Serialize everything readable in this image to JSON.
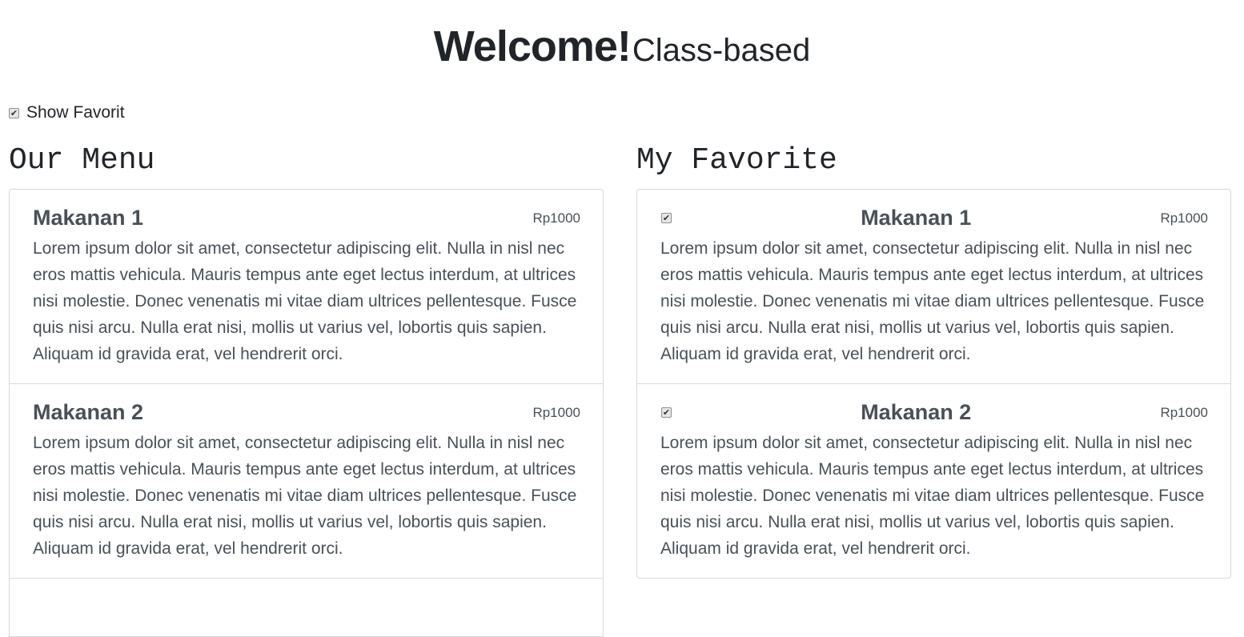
{
  "header": {
    "title": "Welcome!",
    "subtitle": "Class-based"
  },
  "toggle": {
    "label": "Show Favorit",
    "checked": true,
    "check_glyph": "✔"
  },
  "menu": {
    "heading": "Our Menu",
    "items": [
      {
        "name": "Makanan 1",
        "price": "Rp1000",
        "description": "Lorem ipsum dolor sit amet, consectetur adipiscing elit. Nulla in nisl nec eros mattis vehicula. Mauris tempus ante eget lectus interdum, at ultrices nisi molestie. Donec venenatis mi vitae diam ultrices pellentesque. Fusce quis nisi arcu. Nulla erat nisi, mollis ut varius vel, lobortis quis sapien. Aliquam id gravida erat, vel hendrerit orci."
      },
      {
        "name": "Makanan 2",
        "price": "Rp1000",
        "description": "Lorem ipsum dolor sit amet, consectetur adipiscing elit. Nulla in nisl nec eros mattis vehicula. Mauris tempus ante eget lectus interdum, at ultrices nisi molestie. Donec venenatis mi vitae diam ultrices pellentesque. Fusce quis nisi arcu. Nulla erat nisi, mollis ut varius vel, lobortis quis sapien. Aliquam id gravida erat, vel hendrerit orci."
      }
    ]
  },
  "favorites": {
    "heading": "My Favorite",
    "items": [
      {
        "name": "Makanan 1",
        "price": "Rp1000",
        "checked": true,
        "description": "Lorem ipsum dolor sit amet, consectetur adipiscing elit. Nulla in nisl nec eros mattis vehicula. Mauris tempus ante eget lectus interdum, at ultrices nisi molestie. Donec venenatis mi vitae diam ultrices pellentesque. Fusce quis nisi arcu. Nulla erat nisi, mollis ut varius vel, lobortis quis sapien. Aliquam id gravida erat, vel hendrerit orci."
      },
      {
        "name": "Makanan 2",
        "price": "Rp1000",
        "checked": true,
        "description": "Lorem ipsum dolor sit amet, consectetur adipiscing elit. Nulla in nisl nec eros mattis vehicula. Mauris tempus ante eget lectus interdum, at ultrices nisi molestie. Donec venenatis mi vitae diam ultrices pellentesque. Fusce quis nisi arcu. Nulla erat nisi, mollis ut varius vel, lobortis quis sapien. Aliquam id gravida erat, vel hendrerit orci."
      }
    ]
  },
  "colors": {
    "text": "#212529",
    "muted_text": "#495057",
    "border": "#d9d9d9"
  }
}
